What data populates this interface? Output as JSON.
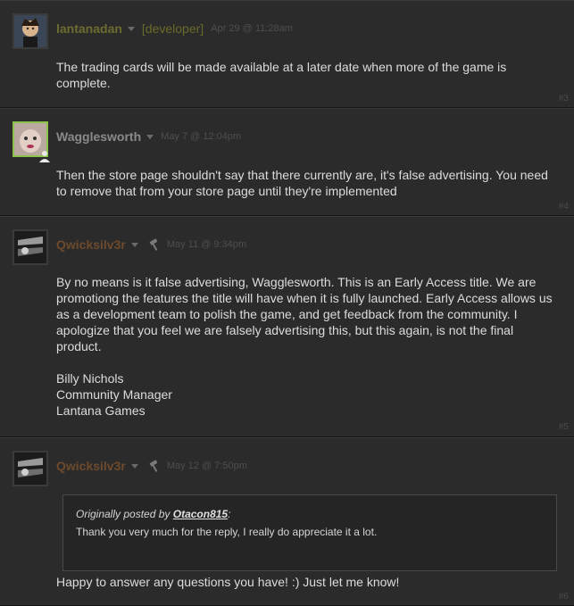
{
  "posts": [
    {
      "author": "lantanadan",
      "tag": "[developer]",
      "date": "Apr 29 @ 11:28am",
      "text": "The trading cards will be made available at a later date when more of the game is complete.",
      "num": "#3"
    },
    {
      "author": "Wagglesworth",
      "date": "May 7 @ 12:04pm",
      "text": "Then the store page shouldn't say that there currently are, it's false advertising. You need to remove that from your store page until they're implemented",
      "num": "#4"
    },
    {
      "author": "Qwicksilv3r",
      "date": "May 11 @ 9:34pm",
      "text": "By no means is it false advertising, Wagglesworth. This is an Early Access title. We are promotiong the features the title will have when it is fully launched. Early Access allows us as a development team to polish the game, and get feedback from the community. I apologize that you feel we are falsely advertising this, but this again, is not the final product.\n\nBilly Nichols\nCommunity Manager\nLantana Games",
      "num": "#5"
    },
    {
      "author": "Qwicksilv3r",
      "date": "May 12 @ 7:50pm",
      "quote": {
        "prefix": "Originally posted by ",
        "author": "Otacon815",
        "suffix": ":",
        "text": "Thank you very much for the reply, I really do appreciate it a lot."
      },
      "text": "Happy to answer any questions you have! :) Just let me know!",
      "num": "#6"
    }
  ],
  "colors": {
    "background": "#1e1e1e",
    "post_bg": "#2b2b2b",
    "author_developer": "#6d6c30",
    "author_normal": "#8a8a8a",
    "author_moderator": "#6e4a2c",
    "online_border": "#8bc34a"
  },
  "icons": {
    "moderator_badge": "hammer-icon",
    "online_status": "person-icon"
  }
}
